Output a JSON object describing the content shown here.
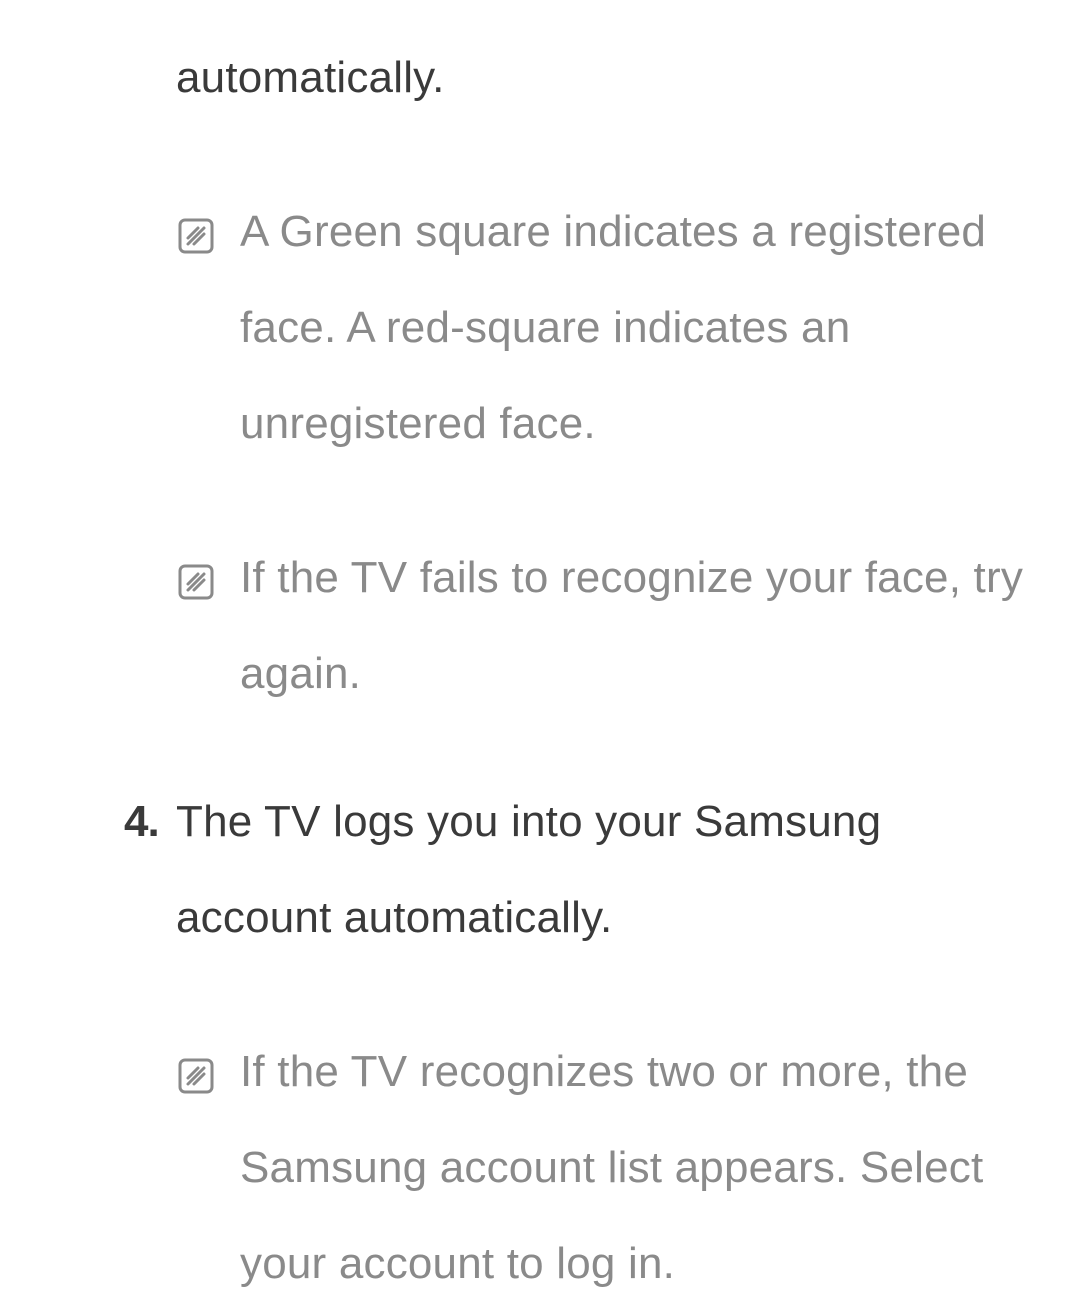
{
  "fragment_top": "automatically.",
  "notes_a": [
    "A Green square indicates a registered face. A red-square indicates an unregistered face.",
    "If the TV fails to recognize your face, try again."
  ],
  "step4": {
    "marker": "4.",
    "text": "The TV logs you into your Samsung account automatically."
  },
  "notes_b": [
    "If the TV recognizes two or more, the Samsung account list appears. Select your account to log in."
  ]
}
